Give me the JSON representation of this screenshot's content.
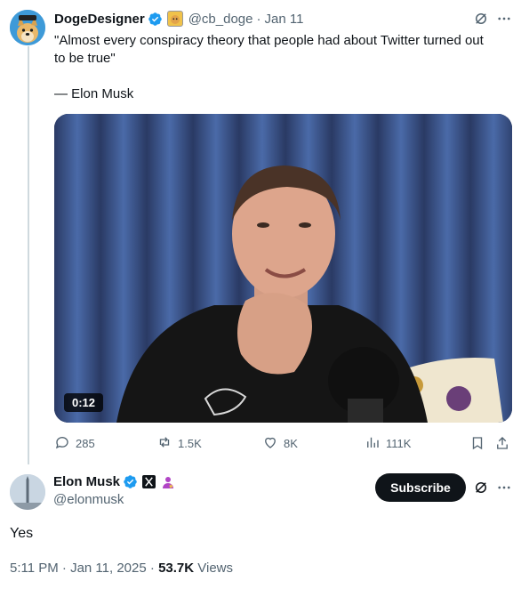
{
  "quoted": {
    "display_name": "DogeDesigner",
    "handle": "@cb_doge",
    "separator": "·",
    "date": "Jan 11",
    "text_line1": "\"Almost every conspiracy theory that people had about Twitter turned out",
    "text_line2": "to be true\"",
    "attribution": "— Elon Musk",
    "video_time": "0:12",
    "actions": {
      "replies": "285",
      "reposts": "1.5K",
      "likes": "8K",
      "views": "111K"
    }
  },
  "main": {
    "display_name": "Elon Musk",
    "handle": "@elonmusk",
    "subscribe_label": "Subscribe",
    "text": "Yes",
    "timestamp": "5:11 PM · Jan 11, 2025",
    "dot": "·",
    "views_count": "53.7K",
    "views_label": "Views"
  },
  "colors": {
    "verified": "#1d9bf0",
    "muted": "#536471",
    "text": "#0f1419",
    "thread_line": "#cfd9de"
  },
  "icons": [
    "grok-icon",
    "more-icon",
    "verified-icon",
    "reply-icon",
    "repost-icon",
    "like-icon",
    "views-icon",
    "bookmark-icon",
    "share-icon",
    "x-badge-icon",
    "affiliate-icon"
  ]
}
